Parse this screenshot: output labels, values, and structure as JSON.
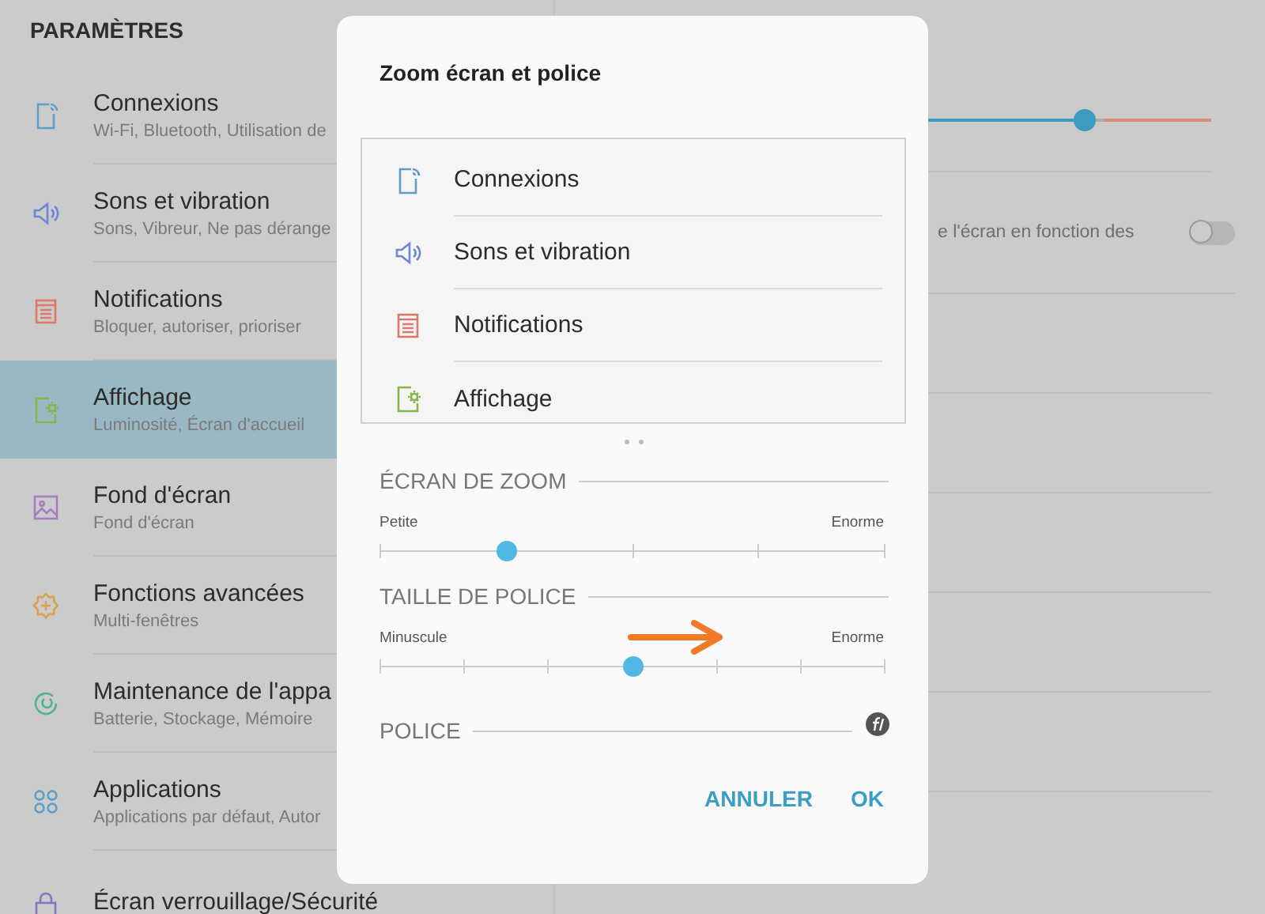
{
  "sidebar": {
    "title": "PARAMÈTRES",
    "items": [
      {
        "kind": "connections",
        "title": "Connexions",
        "subtitle": "Wi-Fi, Bluetooth, Utilisation de",
        "selected": false
      },
      {
        "kind": "sound",
        "title": "Sons et vibration",
        "subtitle": "Sons, Vibreur, Ne pas dérange",
        "selected": false
      },
      {
        "kind": "notifications",
        "title": "Notifications",
        "subtitle": "Bloquer, autoriser, prioriser",
        "selected": false
      },
      {
        "kind": "display",
        "title": "Affichage",
        "subtitle": "Luminosité, Écran d'accueil",
        "selected": true
      },
      {
        "kind": "wallpaper",
        "title": "Fond d'écran",
        "subtitle": "Fond d'écran",
        "selected": false
      },
      {
        "kind": "advanced",
        "title": "Fonctions avancées",
        "subtitle": "Multi-fenêtres",
        "selected": false
      },
      {
        "kind": "maintenance",
        "title": "Maintenance de l'appa",
        "subtitle": "Batterie, Stockage, Mémoire",
        "selected": false
      },
      {
        "kind": "apps",
        "title": "Applications",
        "subtitle": "Applications par défaut, Autor",
        "selected": false
      },
      {
        "kind": "lock",
        "title": "Écran verrouillage/Sécurité",
        "selected": false
      }
    ]
  },
  "content": {
    "brightness": {
      "level": 0.8
    },
    "adaptive": {
      "text": "e l'écran en fonction des",
      "on": false
    }
  },
  "dialog": {
    "title": "Zoom écran et police",
    "preview": [
      {
        "kind": "connections",
        "label": "Connexions"
      },
      {
        "kind": "sound",
        "label": "Sons et vibration"
      },
      {
        "kind": "notifications",
        "label": "Notifications"
      },
      {
        "kind": "display",
        "label": "Affichage"
      }
    ],
    "zoom": {
      "heading": "ÉCRAN DE ZOOM",
      "min_label": "Petite",
      "max_label": "Enorme",
      "level": 0.25
    },
    "font_size": {
      "heading": "TAILLE DE POLICE",
      "min_label": "Minuscule",
      "max_label": "Enorme",
      "level": 0.5
    },
    "font": {
      "heading": "POLICE"
    },
    "buttons": [
      "ANNULER",
      "OK"
    ]
  }
}
